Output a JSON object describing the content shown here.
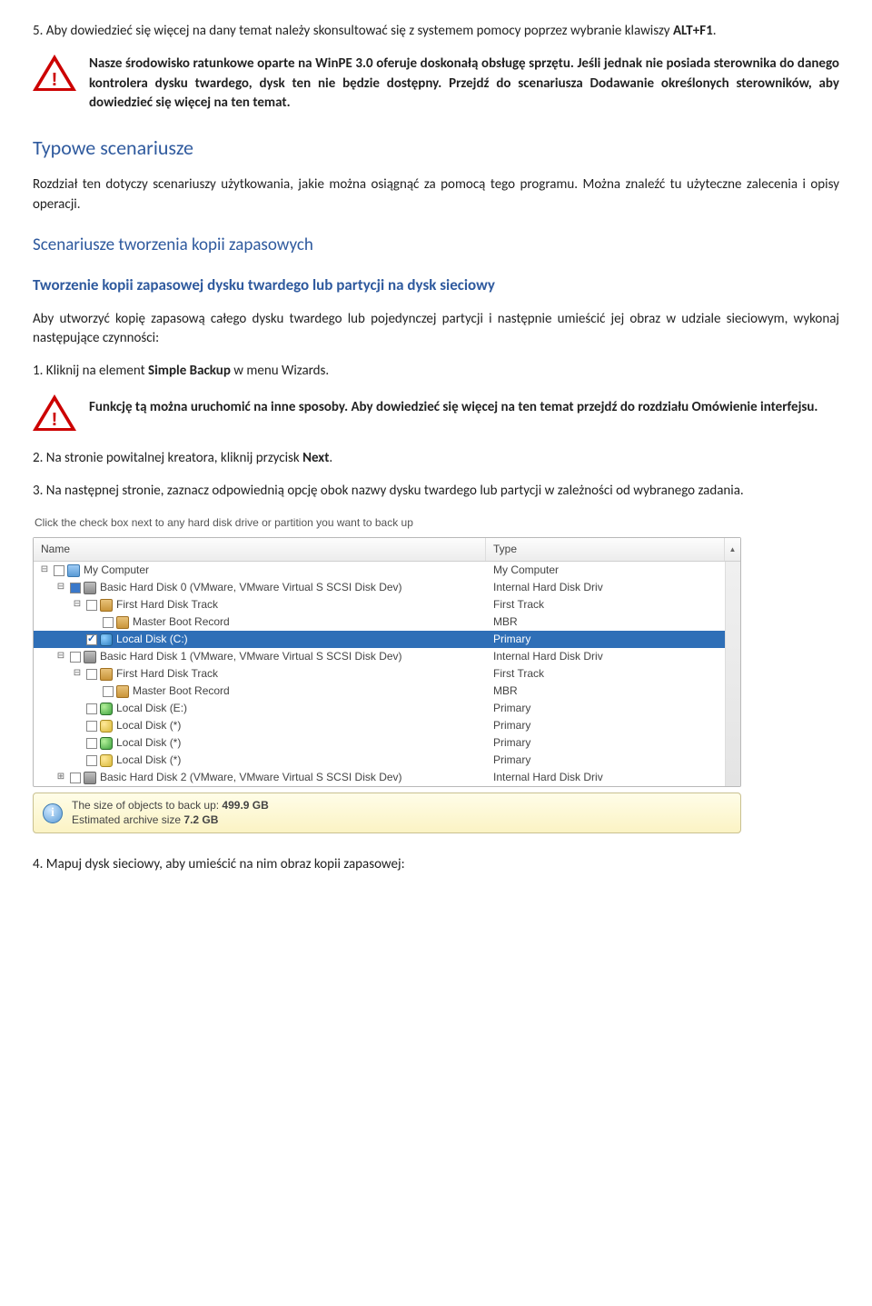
{
  "p1": {
    "pre": "5. Aby dowiedzieć się więcej na dany temat należy skonsultować się z systemem pomocy poprzez wybranie klawiszy ",
    "bold": "ALT+F1",
    "post": "."
  },
  "alert1": "Nasze środowisko ratunkowe oparte na WinPE 3.0 oferuje doskonałą obsługę sprzętu. Jeśli jednak nie posiada sterownika do danego kontrolera dysku twardego, dysk ten nie będzie dostępny. Przejdź do scenariusza Dodawanie określonych sterowników, aby dowiedzieć się więcej na ten temat.",
  "h1": "Typowe scenariusze",
  "p2": "Rozdział ten dotyczy scenariuszy użytkowania, jakie można osiągnąć za pomocą tego programu. Można znaleźć tu użyteczne zalecenia i opisy operacji.",
  "h2": "Scenariusze tworzenia kopii zapasowych",
  "h3": "Tworzenie kopii zapasowej dysku twardego lub partycji na dysk sieciowy",
  "p3": "Aby utworzyć kopię zapasową całego dysku twardego lub pojedynczej partycji i następnie umieścić jej obraz w udziale sieciowym, wykonaj następujące czynności:",
  "p4": {
    "pre": "1. Kliknij na element ",
    "b1": "Simple Backup",
    "mid": " w menu Wizards."
  },
  "alert2": "Funkcję tą można uruchomić na inne sposoby. Aby dowiedzieć się więcej na ten temat przejdź do rozdziału Omówienie interfejsu.",
  "p5": {
    "pre": "2. Na stronie powitalnej kreatora, kliknij przycisk ",
    "b": "Next",
    "post": "."
  },
  "p6": "3. Na następnej stronie, zaznacz odpowiednią opcję obok nazwy dysku twardego lub partycji w zależności od wybranego zadania.",
  "shot": {
    "instr": "Click the check box next to any hard disk drive or partition you want to back up",
    "hdr_name": "Name",
    "hdr_type": "Type",
    "rows": [
      {
        "indent": 0,
        "tw": "⊟",
        "cb": "",
        "icon": "ic-comp",
        "name": "My Computer",
        "type": "My Computer",
        "sel": false
      },
      {
        "indent": 1,
        "tw": "⊟",
        "cb": "fill",
        "icon": "ic-hdd",
        "name": "Basic Hard Disk 0 (VMware, VMware Virtual S SCSI Disk Dev)",
        "type": "Internal Hard Disk Driv",
        "sel": false
      },
      {
        "indent": 2,
        "tw": "⊟",
        "cb": "",
        "icon": "ic-trk",
        "name": "First Hard Disk Track",
        "type": "First Track",
        "sel": false
      },
      {
        "indent": 3,
        "tw": "",
        "cb": "",
        "icon": "ic-trk",
        "name": "Master Boot Record",
        "type": "MBR",
        "sel": false
      },
      {
        "indent": 2,
        "tw": "",
        "cb": "check",
        "icon": "ic-cyl-b",
        "name": "Local Disk (C:)",
        "type": "Primary",
        "sel": true
      },
      {
        "indent": 1,
        "tw": "⊟",
        "cb": "",
        "icon": "ic-hdd",
        "name": "Basic Hard Disk 1 (VMware, VMware Virtual S SCSI Disk Dev)",
        "type": "Internal Hard Disk Driv",
        "sel": false
      },
      {
        "indent": 2,
        "tw": "⊟",
        "cb": "",
        "icon": "ic-trk",
        "name": "First Hard Disk Track",
        "type": "First Track",
        "sel": false
      },
      {
        "indent": 3,
        "tw": "",
        "cb": "",
        "icon": "ic-trk",
        "name": "Master Boot Record",
        "type": "MBR",
        "sel": false
      },
      {
        "indent": 2,
        "tw": "",
        "cb": "",
        "icon": "ic-cyl-g",
        "name": "Local Disk (E:)",
        "type": "Primary",
        "sel": false
      },
      {
        "indent": 2,
        "tw": "",
        "cb": "",
        "icon": "ic-cyl-y",
        "name": "Local Disk (*)",
        "type": "Primary",
        "sel": false
      },
      {
        "indent": 2,
        "tw": "",
        "cb": "",
        "icon": "ic-cyl-g",
        "name": "Local Disk (*)",
        "type": "Primary",
        "sel": false
      },
      {
        "indent": 2,
        "tw": "",
        "cb": "",
        "icon": "ic-cyl-y",
        "name": "Local Disk (*)",
        "type": "Primary",
        "sel": false
      },
      {
        "indent": 1,
        "tw": "⊞",
        "cb": "",
        "icon": "ic-hdd",
        "name": "Basic Hard Disk 2 (VMware, VMware Virtual S SCSI Disk Dev)",
        "type": "Internal Hard Disk Driv",
        "sel": false
      }
    ],
    "info_l1_a": "The size of objects to back up: ",
    "info_l1_b": "499.9 GB",
    "info_l2_a": "Estimated archive size ",
    "info_l2_b": "7.2 GB"
  },
  "p7": "4. Mapuj dysk sieciowy, aby umieścić na nim obraz kopii zapasowej:"
}
